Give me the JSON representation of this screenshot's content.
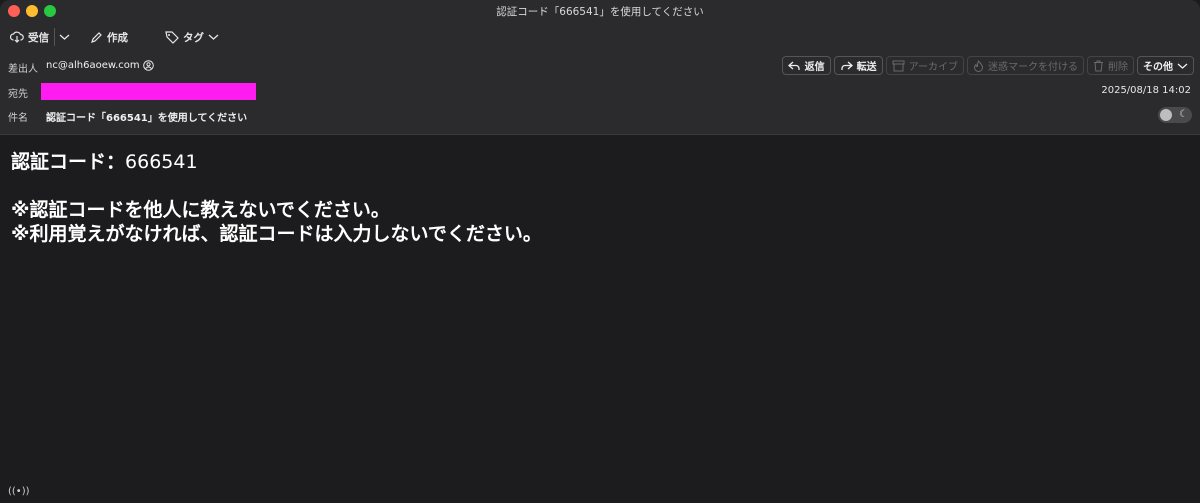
{
  "window": {
    "title": "認証コード「666541」を使用してください"
  },
  "toolbar": {
    "receive_label": "受信",
    "compose_label": "作成",
    "tag_label": "タグ"
  },
  "header": {
    "from_label": "差出人",
    "from_value": "nc@alh6aoew.com",
    "to_label": "宛先",
    "subject_label": "件名",
    "subject_value": "認証コード「666541」を使用してください",
    "date": "2025/08/18 14:02"
  },
  "actions": {
    "reply": "返信",
    "forward": "転送",
    "archive": "アーカイブ",
    "junk": "迷惑マークを付ける",
    "delete": "削除",
    "more": "その他"
  },
  "body": {
    "code_label": "認証コード：",
    "code_value": "666541",
    "line2": "※認証コードを他人に教えないでください。",
    "line3": "※利用覚えがなければ、認証コードは入力しないでください。"
  },
  "colors": {
    "redaction": "#ff1cf0",
    "close": "#ff5f57",
    "minimize": "#febc2e",
    "maximize": "#28c840"
  }
}
